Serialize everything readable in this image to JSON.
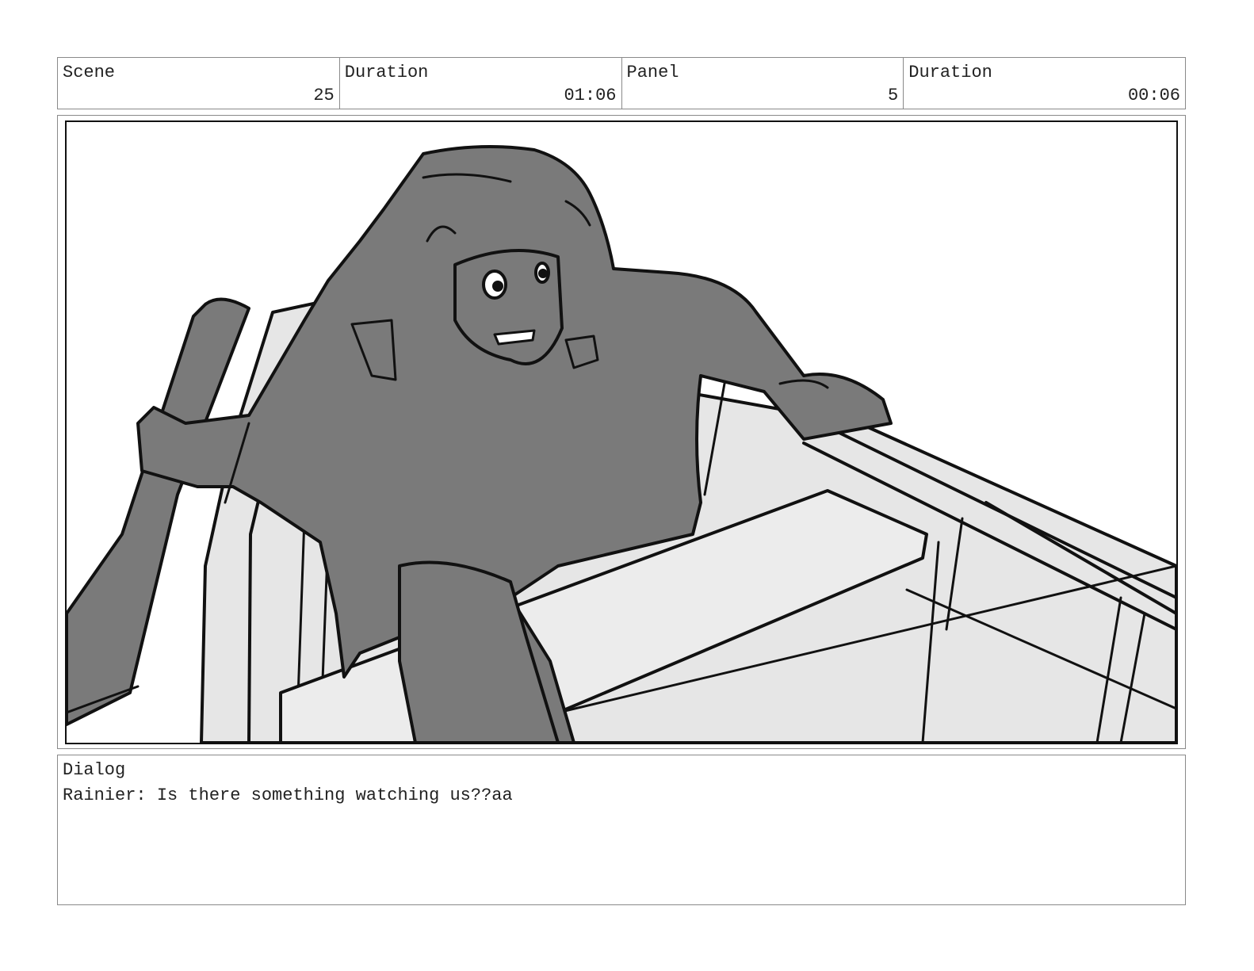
{
  "header": {
    "cells": [
      {
        "label": "Scene",
        "value": "25"
      },
      {
        "label": "Duration",
        "value": "01:06"
      },
      {
        "label": "Panel",
        "value": "5"
      },
      {
        "label": "Duration",
        "value": "00:06"
      }
    ]
  },
  "dialog": {
    "label": "Dialog",
    "text": "Rainier: Is there something watching us??aa"
  },
  "colors": {
    "figure_fill": "#7a7a7a",
    "boat_fill": "#e6e6e6",
    "line": "#111111",
    "border": "#8a8a8a"
  }
}
